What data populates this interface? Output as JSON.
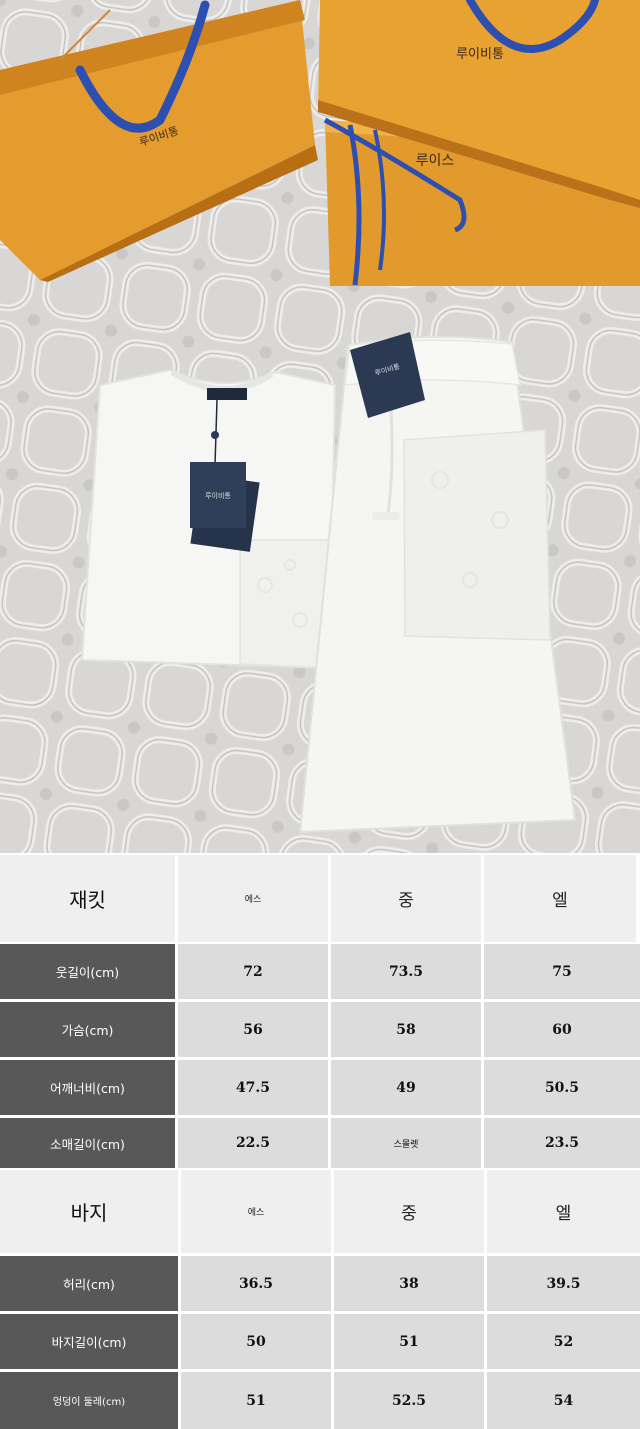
{
  "photo": {
    "bag_text_1": "루이비통",
    "bag_text_2": "루이스",
    "tag_text_shirt": "루이비통",
    "tag_text_shorts": "루이비통",
    "colors": {
      "bag": "#e39a2c",
      "ribbon": "#2f4fb0",
      "blanket": "#d9d8d6",
      "garment": "#f7f7f5",
      "tag": "#2b3a52"
    }
  },
  "jacket": {
    "title": "재킷",
    "sizes": [
      "에스",
      "중",
      "엘"
    ],
    "rows": [
      {
        "label": "웃길이(cm)",
        "values": [
          "72",
          "73.5",
          "75"
        ]
      },
      {
        "label": "가슴(cm)",
        "values": [
          "56",
          "58",
          "60"
        ]
      },
      {
        "label": "어깨너비(cm)",
        "values": [
          "47.5",
          "49",
          "50.5"
        ]
      },
      {
        "label": "소매길이(cm)",
        "values": [
          "22.5",
          "스몰렛",
          "23.5"
        ]
      }
    ]
  },
  "pants": {
    "title": "바지",
    "sizes": [
      "에스",
      "중",
      "엘"
    ],
    "rows": [
      {
        "label": "허리(cm)",
        "values": [
          "36.5",
          "38",
          "39.5"
        ]
      },
      {
        "label": "바지길이(cm)",
        "values": [
          "50",
          "51",
          "52"
        ]
      },
      {
        "label": "엉덩이 둘레(cm)",
        "values": [
          "51",
          "52.5",
          "54"
        ]
      }
    ]
  }
}
